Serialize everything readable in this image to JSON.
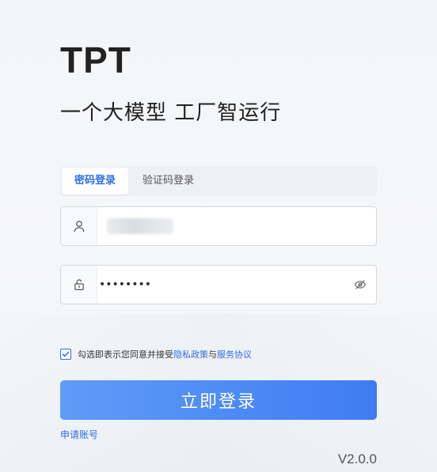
{
  "brand": "TPT",
  "slogan": "一个大模型 工厂智运行",
  "tabs": [
    {
      "label": "密码登录",
      "active": true
    },
    {
      "label": "验证码登录",
      "active": false
    }
  ],
  "username": {
    "icon": "user-icon",
    "value": ""
  },
  "password": {
    "icon": "lock-icon",
    "value": "••••••••",
    "toggle_icon": "eye-slash-icon"
  },
  "agreement": {
    "checked": true,
    "prefix": "勾选即表示您同意并接受",
    "privacy_link": "隐私政策",
    "and": "与",
    "service_link": "服务协议"
  },
  "login_button": "立即登录",
  "apply_account": "申请账号",
  "version": "V2.0.0",
  "colors": {
    "accent": "#2f6ee8",
    "button_start": "#5f9cf7",
    "button_end": "#3f7cf3"
  }
}
